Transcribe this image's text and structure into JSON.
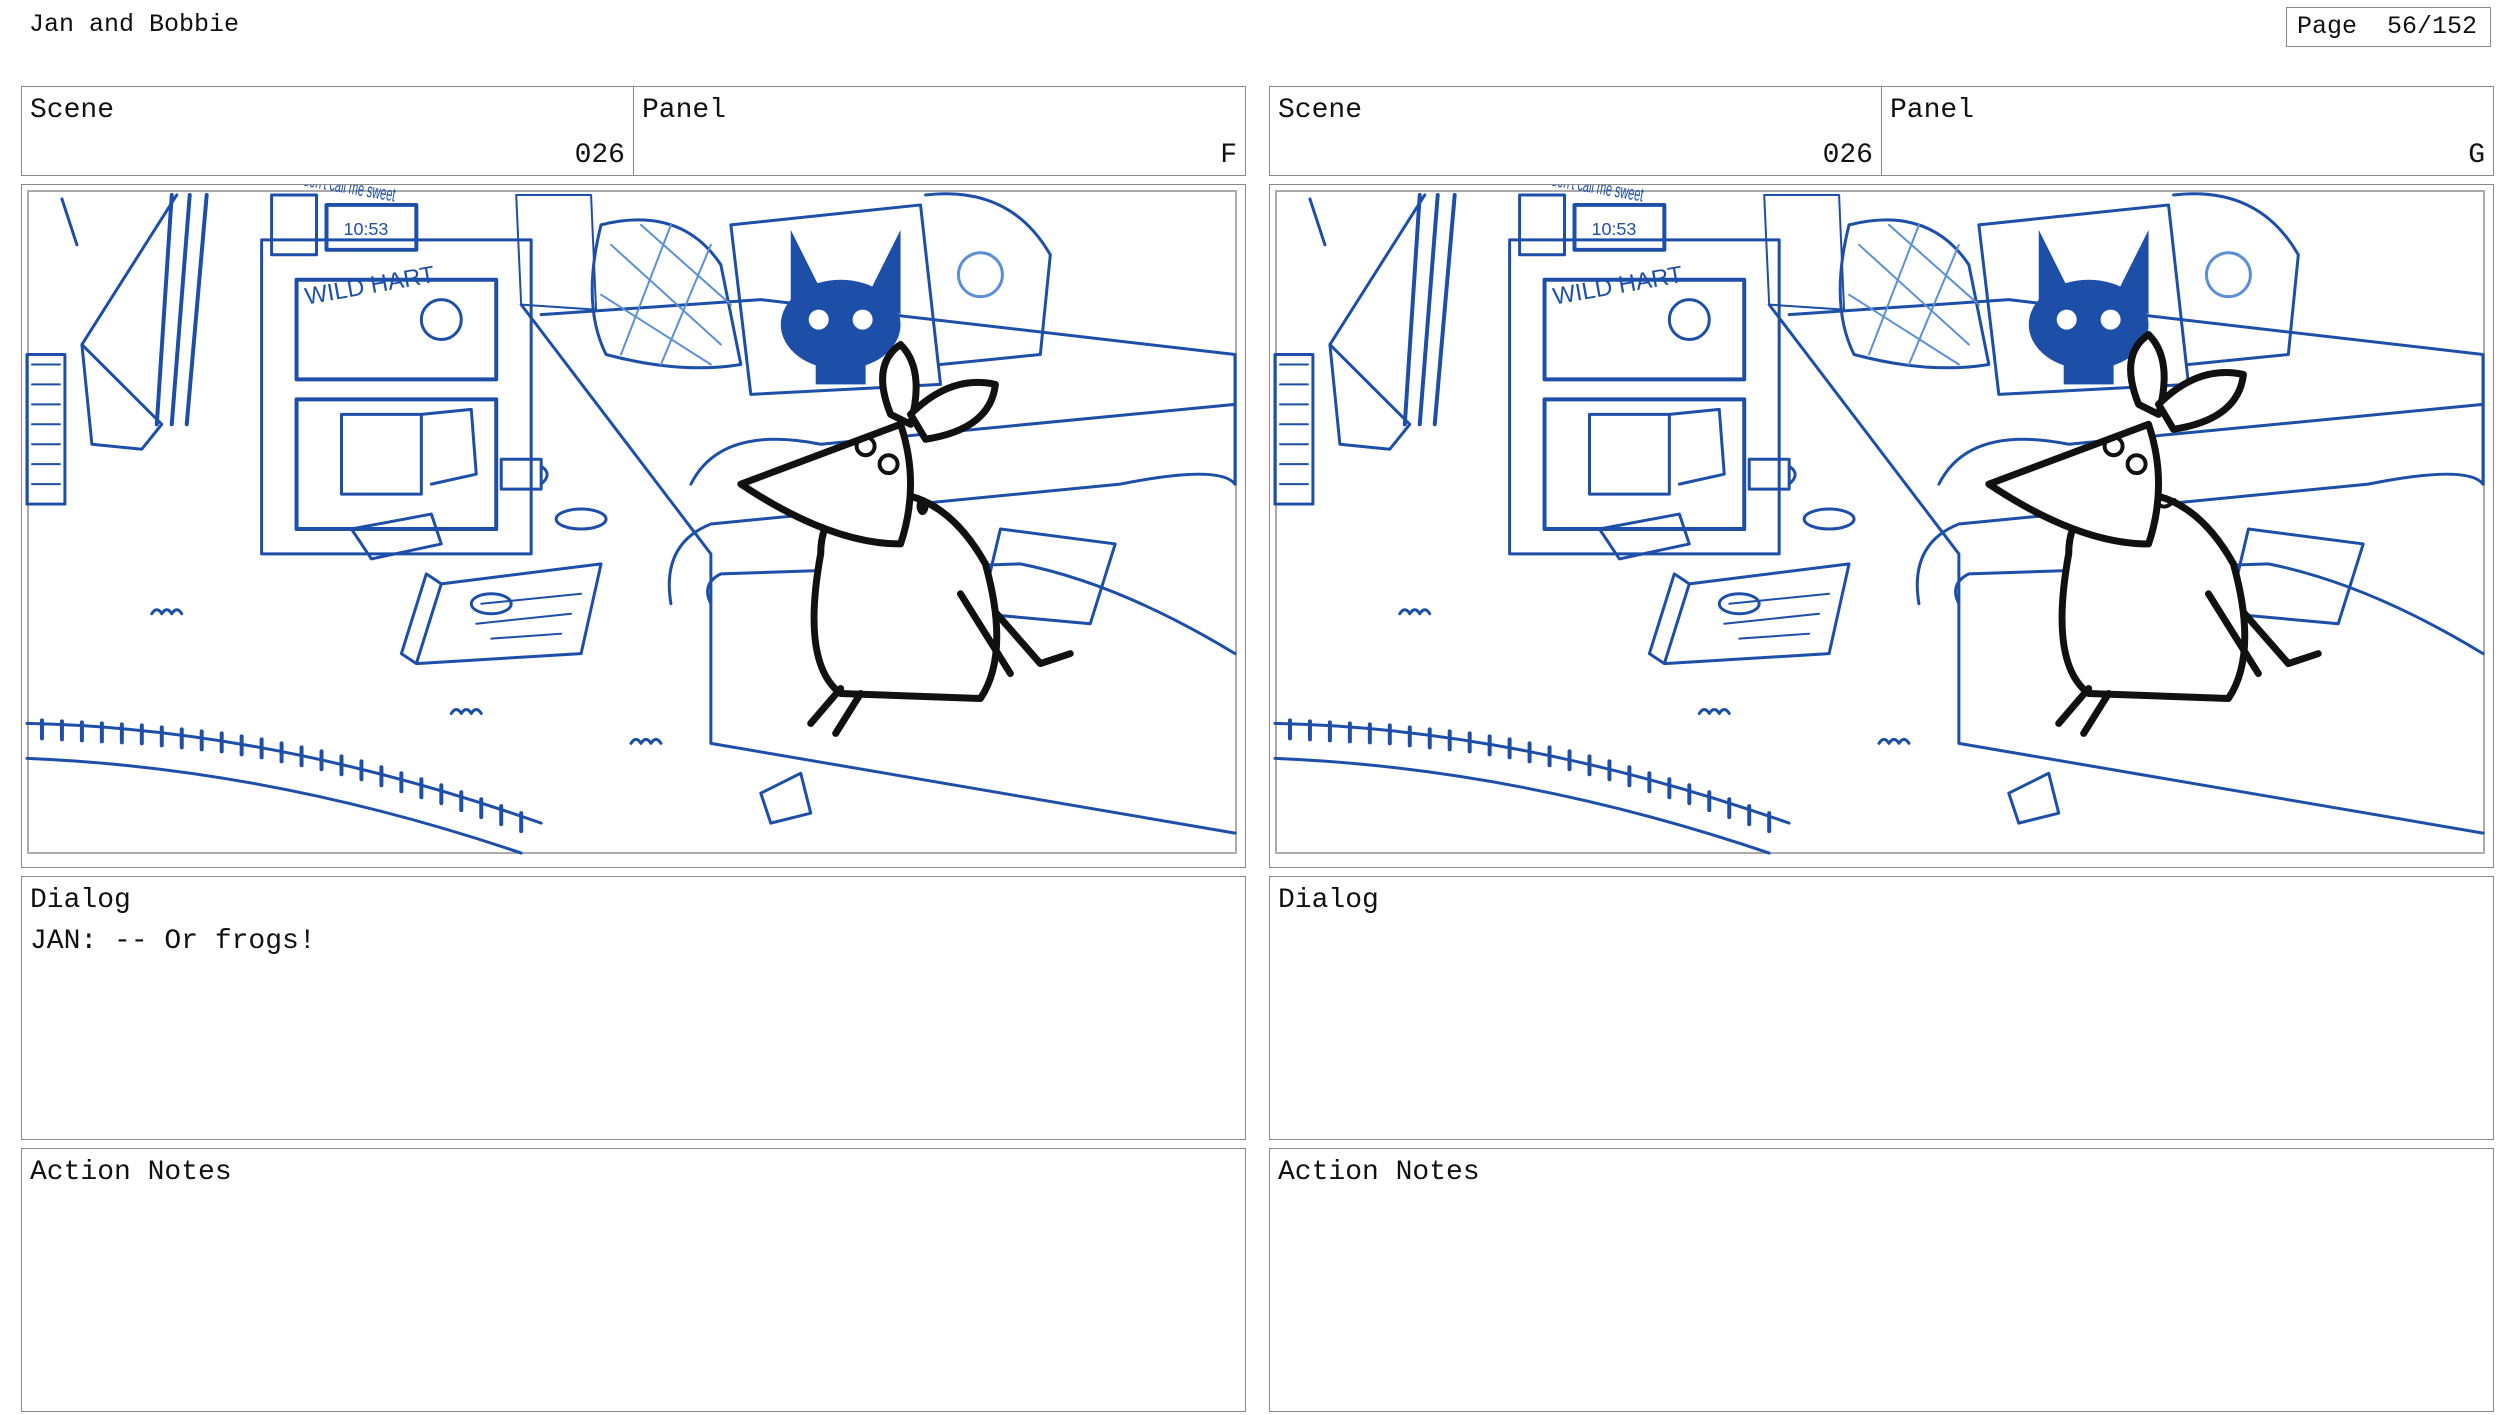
{
  "document": {
    "title": "Jan and Bobbie",
    "page_label": "Page",
    "page_number": "56/152"
  },
  "labels": {
    "scene": "Scene",
    "panel": "Panel",
    "dialog": "Dialog",
    "action_notes": "Action Notes"
  },
  "panels": [
    {
      "scene": "026",
      "panel": "F",
      "dialog": "JAN: -- Or frogs!",
      "action_notes": "",
      "clock_text": "10:53",
      "sign_text": "WILD HART",
      "poster_text": "don't call me sweet",
      "mouth": "open"
    },
    {
      "scene": "026",
      "panel": "G",
      "dialog": "",
      "action_notes": "",
      "clock_text": "10:53",
      "sign_text": "WILD HART",
      "poster_text": "don't call me sweet",
      "mouth": "smile"
    }
  ],
  "colors": {
    "sketch_blue": "#1d4fa8",
    "light_blue": "#5b8fd6",
    "ink": "#111111",
    "border": "#8a8a8a"
  }
}
